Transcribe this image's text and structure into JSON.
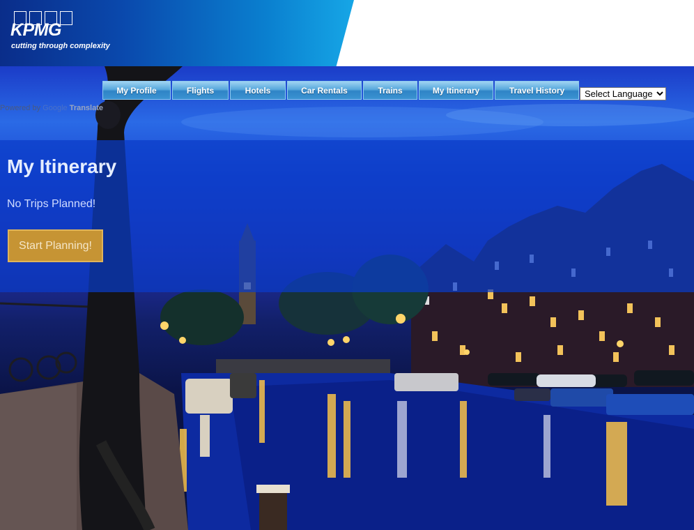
{
  "header": {
    "logo_text": "KPMG",
    "tagline": "cutting through complexity"
  },
  "nav": {
    "items": [
      {
        "label": "My Profile"
      },
      {
        "label": "Flights"
      },
      {
        "label": "Hotels"
      },
      {
        "label": "Car Rentals"
      },
      {
        "label": "Trains"
      },
      {
        "label": "My Itinerary"
      },
      {
        "label": "Travel History"
      }
    ]
  },
  "language": {
    "selected": "Select Language"
  },
  "powered_by": {
    "prefix": "Powered by",
    "google": "Google",
    "translate": "Translate"
  },
  "main": {
    "title": "My Itinerary",
    "empty_message": "No Trips Planned!",
    "start_button": "Start Planning!"
  },
  "colors": {
    "header_blue": "#0a49ad",
    "nav_button": "#3b93d2",
    "panel_overlay": "#0a3cc8",
    "start_button": "#c69434"
  }
}
